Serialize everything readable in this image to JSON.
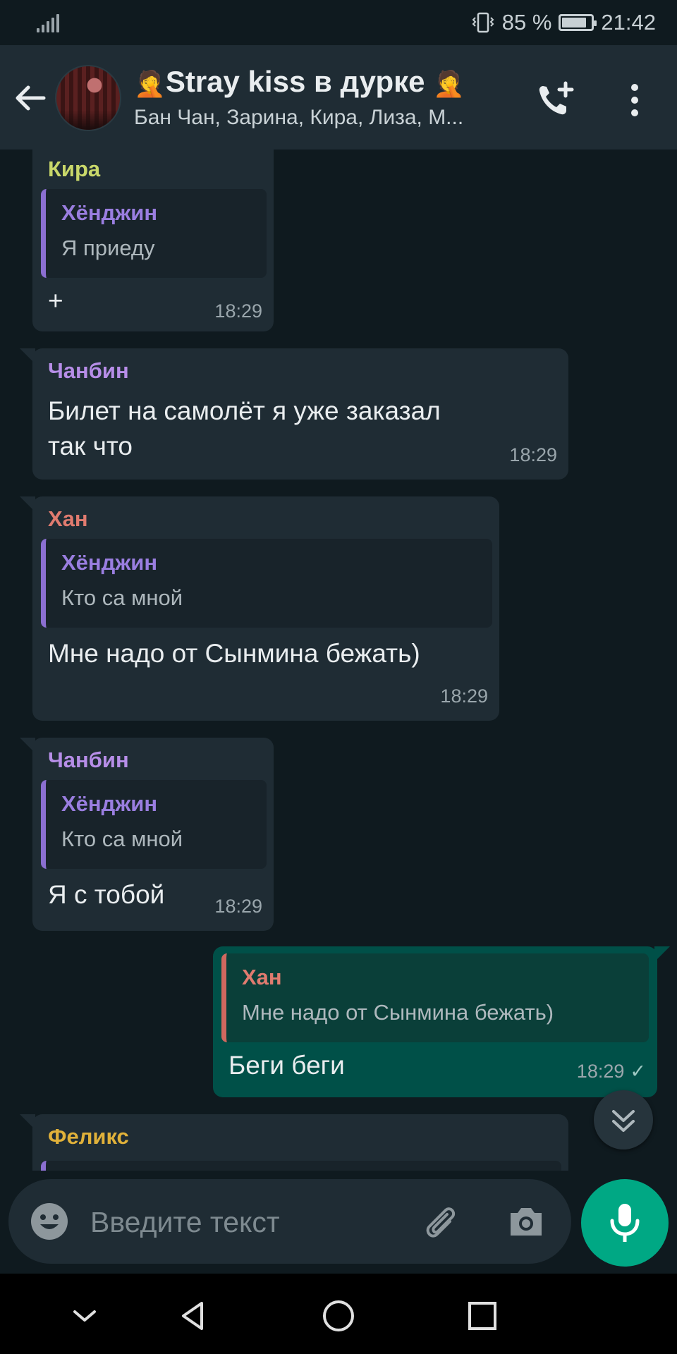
{
  "status_bar": {
    "battery_percent": "85 %",
    "time": "21:42",
    "battery_level": 0.85,
    "icons": [
      "signal-icon",
      "vibrate-icon",
      "battery-icon"
    ]
  },
  "header": {
    "title": "Stray kiss в дурке",
    "emoji": "🤦",
    "subtitle": "Бан Чан, Зарина, Кира, Лиза, М...",
    "icons": [
      "back-arrow-icon",
      "group-avatar",
      "add-call-icon",
      "more-vert-icon"
    ]
  },
  "messages": [
    {
      "sender": "Кира",
      "sender_color": "#c9d86a",
      "quote": {
        "author": "Хёнджин",
        "text": "Я приеду",
        "author_color": "#9a7ee0"
      },
      "text": "+",
      "time": "18:29"
    },
    {
      "sender": "Чанбин",
      "sender_color": "#b78ee8",
      "text_lines": [
        "Билет на самолёт я уже заказал",
        "так что"
      ],
      "time": "18:29"
    },
    {
      "sender": "Хан",
      "sender_color": "#e07b6f",
      "quote": {
        "author": "Хёнджин",
        "text": "Кто са мной",
        "author_color": "#9a7ee0"
      },
      "text": "Мне надо от Сынмина бежать)",
      "time": "18:29"
    },
    {
      "sender": "Чанбин",
      "sender_color": "#b78ee8",
      "quote": {
        "author": "Хёнджин",
        "text": "Кто са мной",
        "author_color": "#9a7ee0"
      },
      "text": "Я с тобой",
      "time": "18:29"
    },
    {
      "outgoing": true,
      "quote": {
        "author": "Хан",
        "text": "Мне надо от Сынмина бежать)",
        "author_color": "#e07b6f"
      },
      "text": "Беги беги",
      "time": "18:29",
      "status": "✓"
    },
    {
      "sender": "Феликс",
      "sender_color": "#e0b13a"
    }
  ],
  "input": {
    "placeholder": "Введите текст",
    "icons": [
      "emoji-icon",
      "attach-icon",
      "camera-icon",
      "mic-icon"
    ]
  },
  "scroll_down_icon": "double-chevron-down-icon",
  "nav_icons": [
    "nav-hide-icon",
    "nav-back-icon",
    "nav-home-icon",
    "nav-recents-icon"
  ],
  "colors": {
    "background": "#0f1a1f",
    "bubble_in": "#1f2c34",
    "bubble_out": "#005048",
    "accent": "#00a884"
  }
}
